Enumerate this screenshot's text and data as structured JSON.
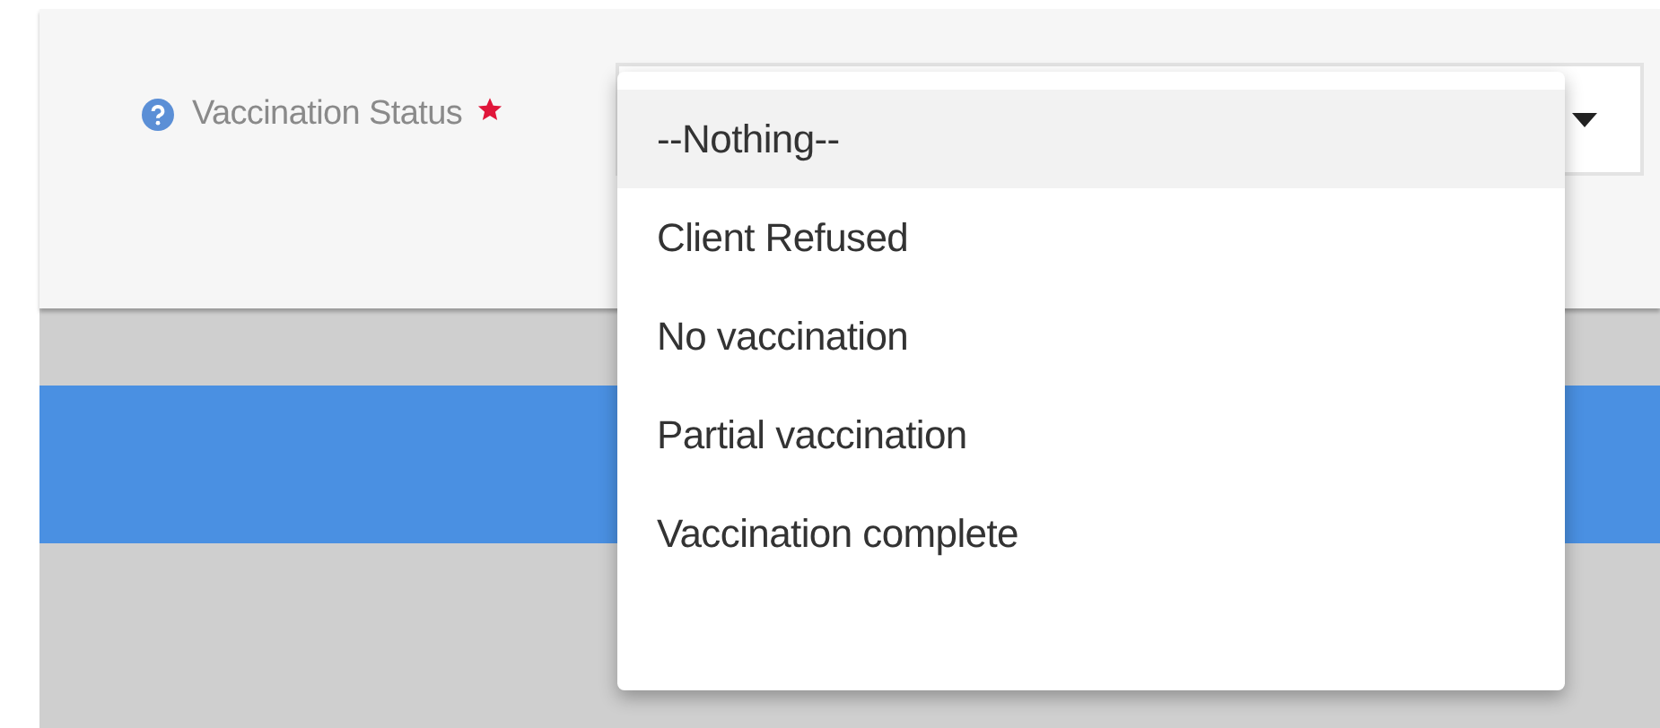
{
  "field": {
    "label": "Vaccination Status",
    "required": true
  },
  "dropdown": {
    "expanded": true,
    "options": [
      {
        "label": "--Nothing--",
        "selected": true
      },
      {
        "label": "Client Refused",
        "selected": false
      },
      {
        "label": "No vaccination",
        "selected": false
      },
      {
        "label": "Partial vaccination",
        "selected": false
      },
      {
        "label": "Vaccination complete",
        "selected": false
      }
    ]
  }
}
